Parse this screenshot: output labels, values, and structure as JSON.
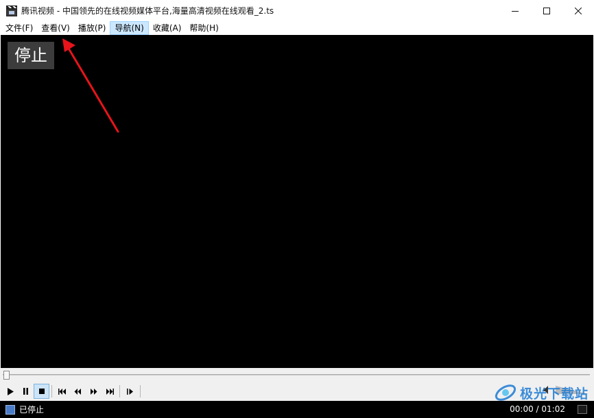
{
  "window": {
    "title": "腾讯视频 - 中国领先的在线视频媒体平台,海量高清视频在线观看_2.ts",
    "app_icon": "clapperboard-icon",
    "controls": [
      "minimize-icon",
      "maximize-icon",
      "close-icon"
    ]
  },
  "menubar": {
    "items": [
      {
        "label": "文件(F)"
      },
      {
        "label": "查看(V)"
      },
      {
        "label": "播放(P)"
      },
      {
        "label": "导航(N)"
      },
      {
        "label": "收藏(A)"
      },
      {
        "label": "帮助(H)"
      }
    ],
    "active_index": 3
  },
  "video": {
    "osd_text": "停止",
    "background": "#000000"
  },
  "annotation": {
    "type": "arrow",
    "color": "#e8141b",
    "points_to": "查看(V)"
  },
  "seekbar": {
    "progress": 0
  },
  "controls": {
    "buttons": [
      "play-icon",
      "pause-icon",
      "stop-icon",
      "skip-back-icon",
      "rewind-icon",
      "fast-forward-icon",
      "skip-forward-icon",
      "frame-step-icon"
    ],
    "pressed": "stop-icon"
  },
  "statusbar": {
    "state": "已停止",
    "time": "00:00 / 01:02"
  },
  "watermark": {
    "text": "极光下载站"
  },
  "colors": {
    "menu_active_bg": "#cce8ff",
    "chrome_bg": "#f0f0f0",
    "arrow": "#e8141b",
    "watermark": "#1d7bd4"
  }
}
